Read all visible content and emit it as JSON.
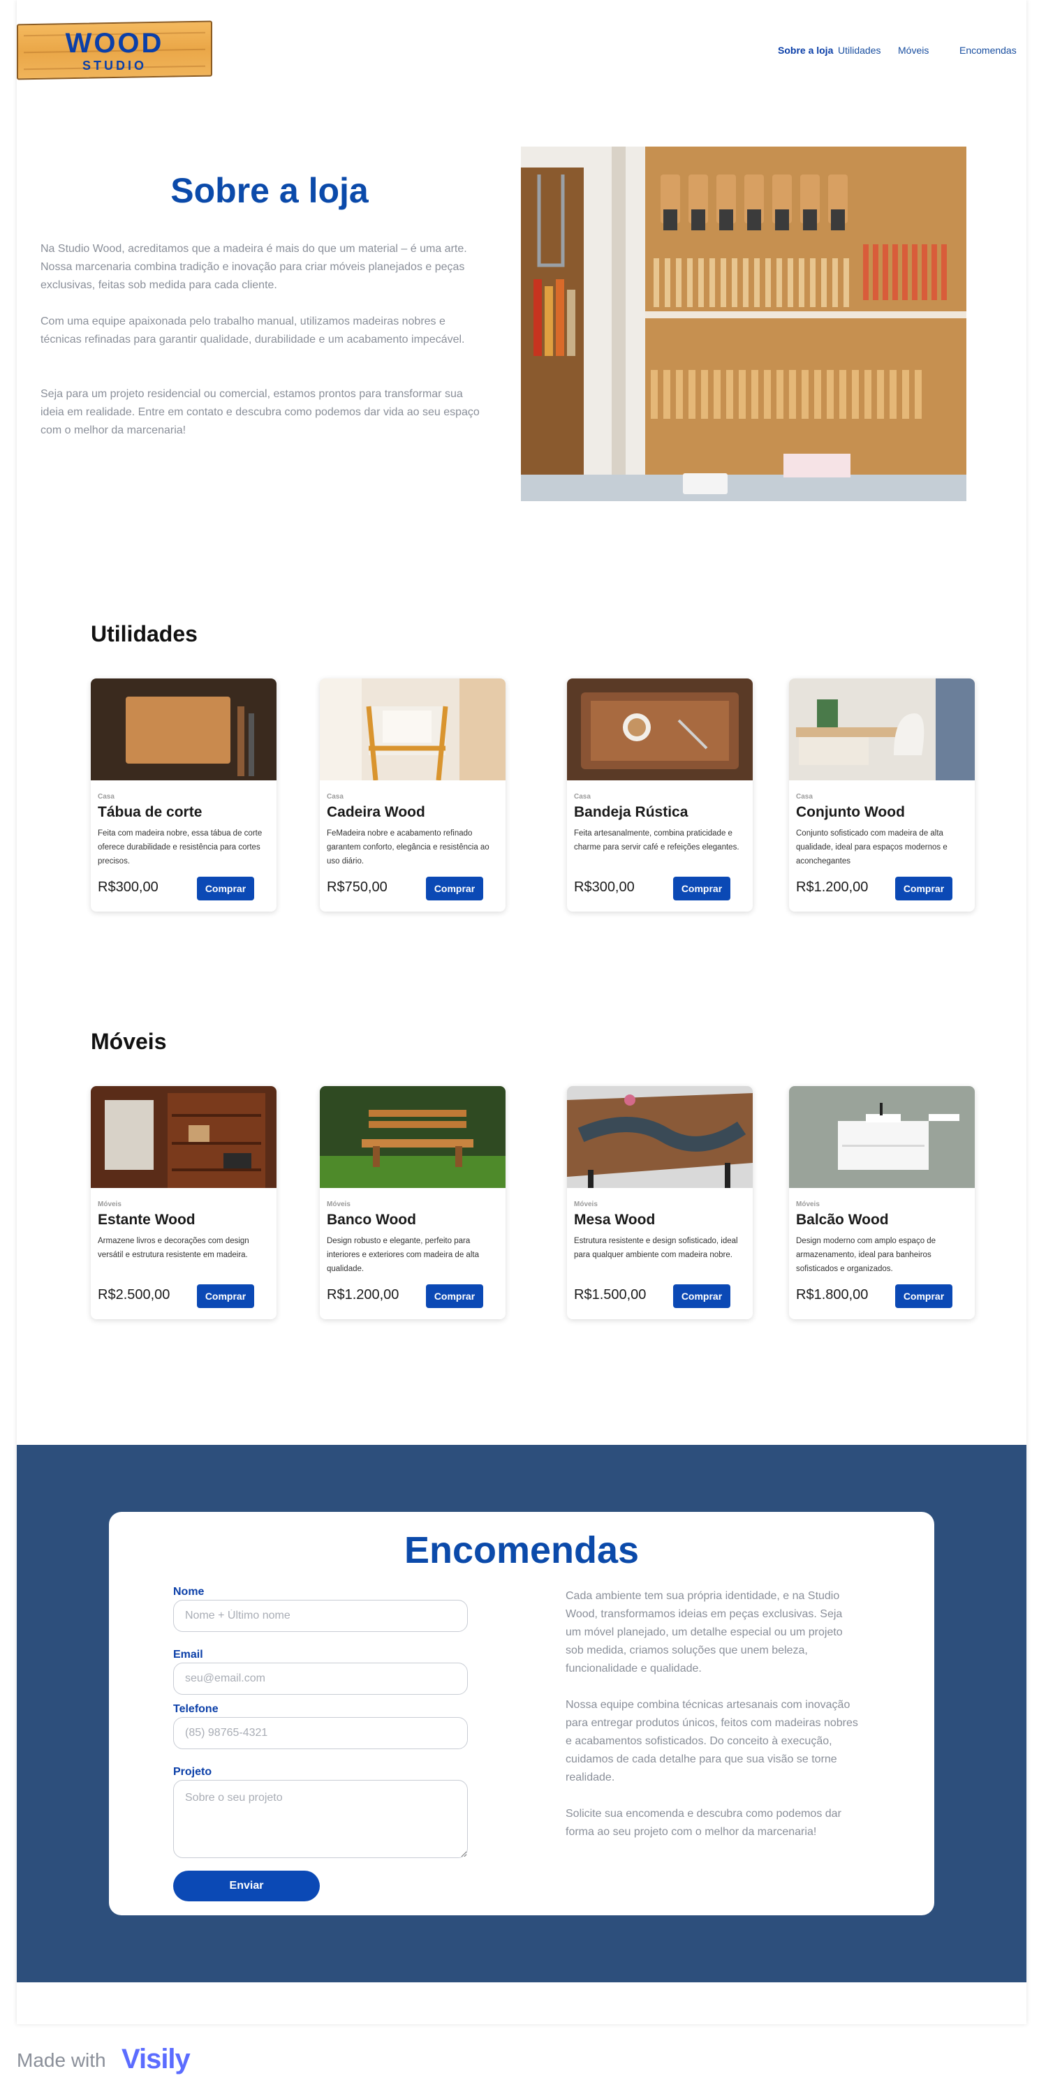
{
  "brand": {
    "logo_line1": "WOOD",
    "logo_line2": "STUDIO"
  },
  "nav": {
    "items": [
      {
        "label": "Sobre a loja",
        "active": true
      },
      {
        "label": "Utilidades",
        "active": false
      },
      {
        "label": "Móveis",
        "active": false
      },
      {
        "label": "Encomendas",
        "active": false
      }
    ]
  },
  "about": {
    "title": "Sobre a loja",
    "paragraphs": [
      "Na Studio Wood, acreditamos que a madeira é mais do que um material – é uma arte. Nossa marcenaria combina tradição e inovação para criar móveis planejados e peças exclusivas, feitas sob medida para cada cliente.",
      "Com uma equipe apaixonada pelo trabalho manual, utilizamos madeiras nobres e técnicas refinadas para garantir qualidade, durabilidade e um acabamento impecável.",
      "Seja para um projeto residencial ou comercial, estamos prontos para transformar sua ideia em realidade. Entre em contato e descubra como podemos dar vida ao seu espaço com o melhor da marcenaria!"
    ]
  },
  "utilidades": {
    "title": "Utilidades",
    "products": [
      {
        "category": "Casa",
        "name": "Tábua de corte",
        "description": "Feita com madeira nobre, essa tábua de corte oferece durabilidade e resistência para cortes precisos.",
        "price": "R$300,00",
        "button": "Comprar"
      },
      {
        "category": "Casa",
        "name": "Cadeira Wood",
        "description": "FeMadeira nobre e acabamento refinado garantem conforto, elegância e resistência ao uso diário.",
        "price": "R$750,00",
        "button": "Comprar"
      },
      {
        "category": "Casa",
        "name": "Bandeja Rústica",
        "description": "Feita artesanalmente, combina praticidade e charme para servir café e refeições elegantes.",
        "price": "R$300,00",
        "button": "Comprar"
      },
      {
        "category": "Casa",
        "name": "Conjunto Wood",
        "description": "Conjunto sofisticado com madeira de alta qualidade, ideal para espaços modernos e aconchegantes",
        "price": "R$1.200,00",
        "button": "Comprar"
      }
    ]
  },
  "moveis": {
    "title": "Móveis",
    "products": [
      {
        "category": "Móveis",
        "name": "Estante Wood",
        "description": "Armazene livros e decorações com design versátil e estrutura resistente em madeira.",
        "price": "R$2.500,00",
        "button": "Comprar"
      },
      {
        "category": "Móveis",
        "name": "Banco Wood",
        "description": "Design robusto e elegante, perfeito para interiores e exteriores com madeira de alta qualidade.",
        "price": "R$1.200,00",
        "button": "Comprar"
      },
      {
        "category": "Móveis",
        "name": "Mesa Wood",
        "description": "Estrutura resistente e design sofisticado, ideal para qualquer ambiente com madeira nobre.",
        "price": "R$1.500,00",
        "button": "Comprar"
      },
      {
        "category": "Móveis",
        "name": "Balcão Wood",
        "description": "Design moderno com amplo espaço de armazenamento, ideal para banheiros sofisticados e organizados.",
        "price": "R$1.800,00",
        "button": "Comprar"
      }
    ]
  },
  "orders": {
    "title": "Encomendas",
    "form": {
      "name_label": "Nome",
      "name_placeholder": "Nome + Último nome",
      "email_label": "Email",
      "email_placeholder": "seu@email.com",
      "phone_label": "Telefone",
      "phone_placeholder": "(85) 98765-4321",
      "project_label": "Projeto",
      "project_placeholder": "Sobre o seu projeto",
      "submit": "Enviar"
    },
    "paragraphs": [
      "Cada ambiente tem sua própria identidade, e na Studio Wood, transformamos ideias em peças exclusivas. Seja um móvel planejado, um detalhe especial ou um projeto sob medida, criamos soluções que unem beleza, funcionalidade e qualidade.",
      "Nossa equipe combina técnicas artesanais com inovação para entregar produtos únicos, feitos com madeiras nobres e acabamentos sofisticados. Do conceito à execução, cuidamos de cada detalhe para que sua visão se torne realidade.",
      "Solicite sua encomenda e descubra como podemos dar forma ao seu projeto com o melhor da marcenaria!"
    ]
  },
  "footer": {
    "made_with": "Made with",
    "brand": "Visily"
  }
}
